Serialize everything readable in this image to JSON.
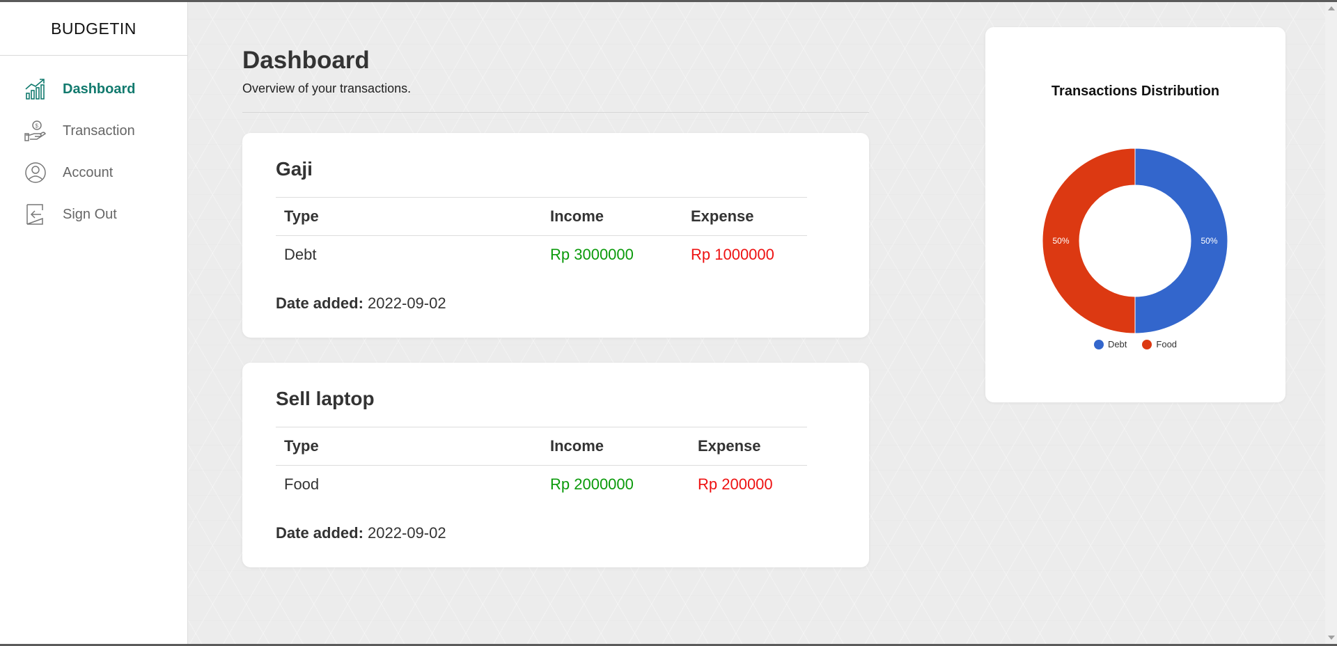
{
  "app": {
    "brand": "BUDGETIN"
  },
  "sidebar": {
    "items": [
      {
        "label": "Dashboard",
        "icon": "chart-growth-icon",
        "active": true
      },
      {
        "label": "Transaction",
        "icon": "money-hand-icon",
        "active": false
      },
      {
        "label": "Account",
        "icon": "user-circle-icon",
        "active": false
      },
      {
        "label": "Sign Out",
        "icon": "sign-out-icon",
        "active": false
      }
    ]
  },
  "header": {
    "title": "Dashboard",
    "subtitle": "Overview of your transactions."
  },
  "table_headers": {
    "type": "Type",
    "income": "Income",
    "expense": "Expense"
  },
  "date_label": "Date added:",
  "transactions": [
    {
      "title": "Gaji",
      "type": "Debt",
      "income": "Rp 3000000",
      "expense": "Rp 1000000",
      "date": "2022-09-02"
    },
    {
      "title": "Sell laptop",
      "type": "Food",
      "income": "Rp 2000000",
      "expense": "Rp 200000",
      "date": "2022-09-02"
    }
  ],
  "colors": {
    "accent": "#127a6e",
    "income": "#0a9a0a",
    "expense": "#ee1111",
    "debt": "#3366cc",
    "food": "#dc3912"
  },
  "chart_data": {
    "type": "pie",
    "title": "Transactions Distribution",
    "categories": [
      "Debt",
      "Food"
    ],
    "values": [
      50,
      50
    ],
    "labels": [
      "50%",
      "50%"
    ],
    "colors": [
      "#3366cc",
      "#dc3912"
    ],
    "legend": "bottom",
    "donut": true
  }
}
